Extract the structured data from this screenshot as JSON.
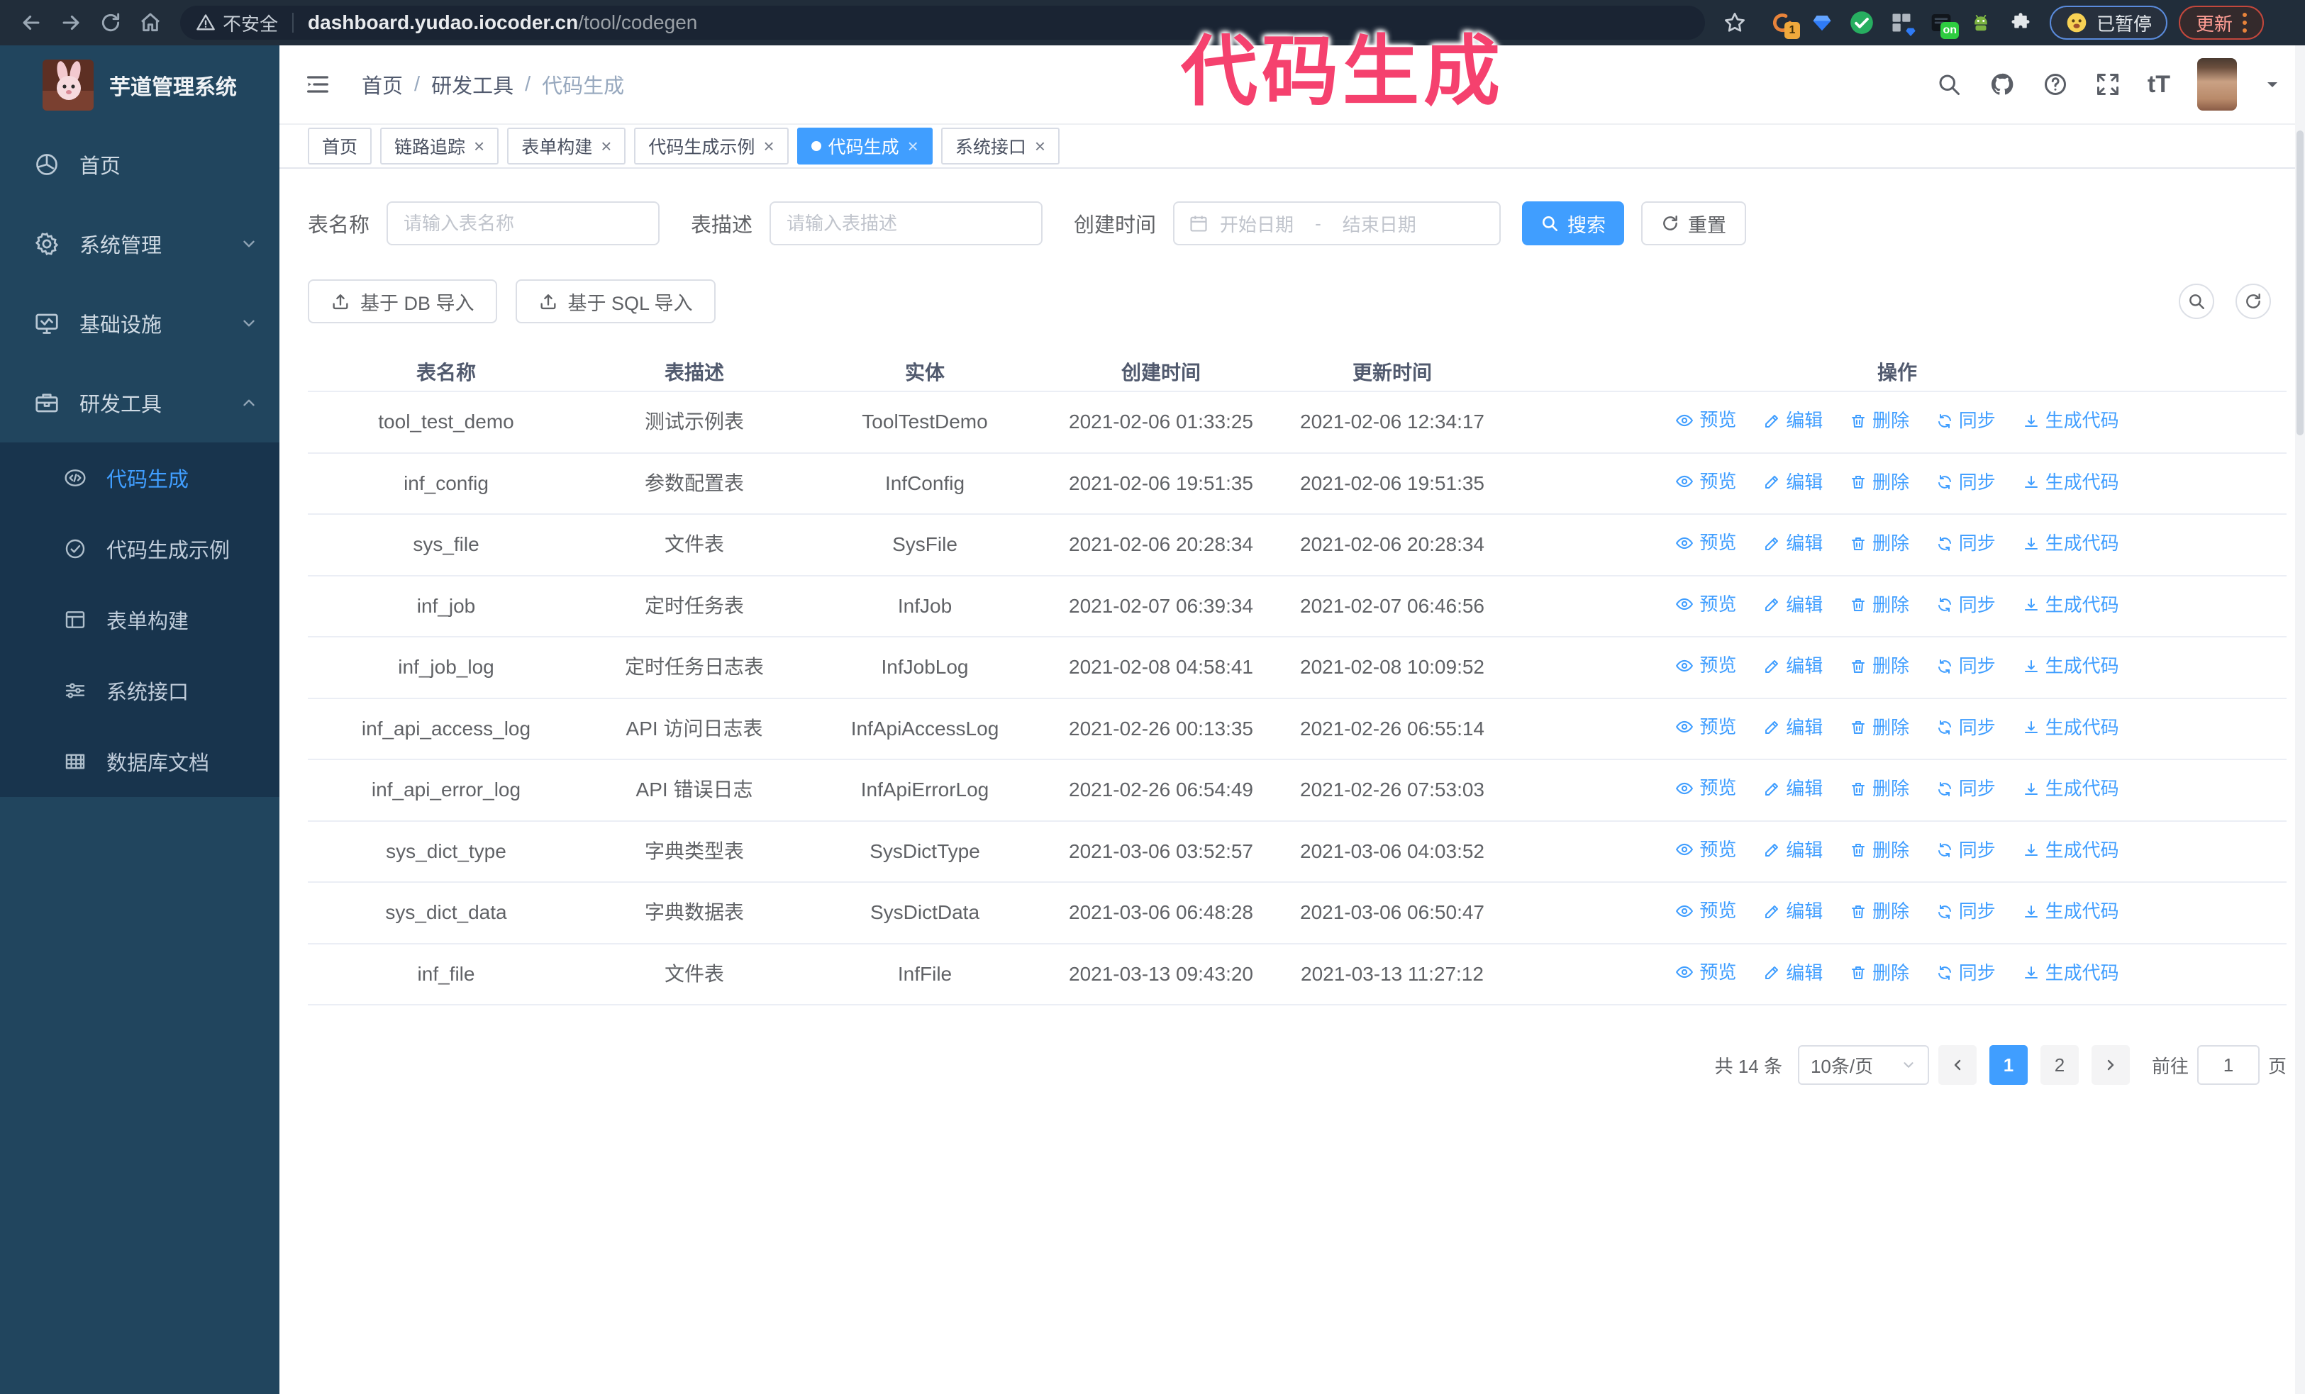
{
  "colors": {
    "accent": "#409eff",
    "sidebar_bg": "#21455e",
    "submenu_bg": "#18344d",
    "annotation": "#f5416e",
    "browser_bar": "#212d3a"
  },
  "browser": {
    "security_label": "不安全",
    "url_host": "dashboard.yudao.iocoder.cn",
    "url_path": "/tool/codegen",
    "extension_badge": "1",
    "extension_on_badge": "on",
    "paused_badge": "已暂停",
    "update_label": "更新"
  },
  "annotation": {
    "text": "代码生成"
  },
  "sidebar": {
    "title": "芋道管理系统",
    "items": [
      {
        "label": "首页"
      },
      {
        "label": "系统管理"
      },
      {
        "label": "基础设施"
      },
      {
        "label": "研发工具"
      }
    ],
    "submenu": [
      {
        "label": "代码生成",
        "active": true
      },
      {
        "label": "代码生成示例"
      },
      {
        "label": "表单构建"
      },
      {
        "label": "系统接口"
      },
      {
        "label": "数据库文档"
      }
    ]
  },
  "header": {
    "breadcrumb": [
      "首页",
      "研发工具",
      "代码生成"
    ]
  },
  "tabs": [
    {
      "label": "首页",
      "closable": false
    },
    {
      "label": "链路追踪",
      "closable": true
    },
    {
      "label": "表单构建",
      "closable": true
    },
    {
      "label": "代码生成示例",
      "closable": true
    },
    {
      "label": "代码生成",
      "closable": true,
      "active": true
    },
    {
      "label": "系统接口",
      "closable": true
    }
  ],
  "filters": {
    "name_label": "表名称",
    "name_placeholder": "请输入表名称",
    "desc_label": "表描述",
    "desc_placeholder": "请输入表描述",
    "time_label": "创建时间",
    "start_placeholder": "开始日期",
    "range_separator": "-",
    "end_placeholder": "结束日期",
    "search_label": "搜索",
    "reset_label": "重置"
  },
  "toolbar": {
    "import_db": "基于 DB 导入",
    "import_sql": "基于 SQL 导入"
  },
  "table": {
    "columns": [
      "表名称",
      "表描述",
      "实体",
      "创建时间",
      "更新时间",
      "操作"
    ],
    "actions": [
      "预览",
      "编辑",
      "删除",
      "同步",
      "生成代码"
    ],
    "rows": [
      {
        "name": "tool_test_demo",
        "desc": "测试示例表",
        "entity": "ToolTestDemo",
        "created": "2021-02-06 01:33:25",
        "updated": "2021-02-06 12:34:17"
      },
      {
        "name": "inf_config",
        "desc": "参数配置表",
        "entity": "InfConfig",
        "created": "2021-02-06 19:51:35",
        "updated": "2021-02-06 19:51:35"
      },
      {
        "name": "sys_file",
        "desc": "文件表",
        "entity": "SysFile",
        "created": "2021-02-06 20:28:34",
        "updated": "2021-02-06 20:28:34"
      },
      {
        "name": "inf_job",
        "desc": "定时任务表",
        "entity": "InfJob",
        "created": "2021-02-07 06:39:34",
        "updated": "2021-02-07 06:46:56"
      },
      {
        "name": "inf_job_log",
        "desc": "定时任务日志表",
        "entity": "InfJobLog",
        "created": "2021-02-08 04:58:41",
        "updated": "2021-02-08 10:09:52"
      },
      {
        "name": "inf_api_access_log",
        "desc": "API 访问日志表",
        "entity": "InfApiAccessLog",
        "created": "2021-02-26 00:13:35",
        "updated": "2021-02-26 06:55:14"
      },
      {
        "name": "inf_api_error_log",
        "desc": "API 错误日志",
        "entity": "InfApiErrorLog",
        "created": "2021-02-26 06:54:49",
        "updated": "2021-02-26 07:53:03"
      },
      {
        "name": "sys_dict_type",
        "desc": "字典类型表",
        "entity": "SysDictType",
        "created": "2021-03-06 03:52:57",
        "updated": "2021-03-06 04:03:52"
      },
      {
        "name": "sys_dict_data",
        "desc": "字典数据表",
        "entity": "SysDictData",
        "created": "2021-03-06 06:48:28",
        "updated": "2021-03-06 06:50:47"
      },
      {
        "name": "inf_file",
        "desc": "文件表",
        "entity": "InfFile",
        "created": "2021-03-13 09:43:20",
        "updated": "2021-03-13 11:27:12"
      }
    ]
  },
  "pagination": {
    "total": "共 14 条",
    "page_size": "10条/页",
    "pages": [
      "1",
      "2"
    ],
    "active_page": "1",
    "goto_label": "前往",
    "goto_value": "1",
    "page_unit": "页"
  }
}
